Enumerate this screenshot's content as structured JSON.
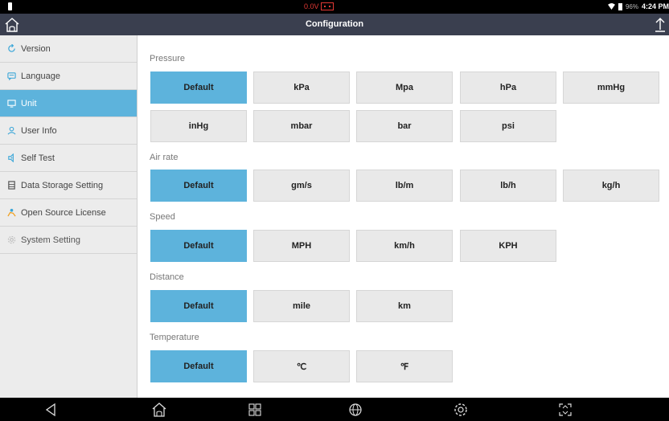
{
  "status": {
    "voltage": "0.0V",
    "battery_pct": "96%",
    "time": "4:24 PM"
  },
  "header": {
    "title": "Configuration"
  },
  "sidebar": {
    "items": [
      {
        "label": "Version",
        "icon": "refresh-icon"
      },
      {
        "label": "Language",
        "icon": "chat-icon"
      },
      {
        "label": "Unit",
        "icon": "monitor-icon"
      },
      {
        "label": "User Info",
        "icon": "user-icon"
      },
      {
        "label": "Self Test",
        "icon": "self-test-icon"
      },
      {
        "label": "Data Storage Setting",
        "icon": "storage-icon"
      },
      {
        "label": "Open Source License",
        "icon": "license-icon"
      },
      {
        "label": "System Setting",
        "icon": "gear-icon"
      }
    ],
    "active": "Unit"
  },
  "sections": {
    "pressure": {
      "label": "Pressure",
      "options": [
        "Default",
        "kPa",
        "Mpa",
        "hPa",
        "mmHg",
        "inHg",
        "mbar",
        "bar",
        "psi"
      ],
      "selected": "Default"
    },
    "air_rate": {
      "label": "Air rate",
      "options": [
        "Default",
        "gm/s",
        "lb/m",
        "lb/h",
        "kg/h"
      ],
      "selected": "Default"
    },
    "speed": {
      "label": "Speed",
      "options": [
        "Default",
        "MPH",
        "km/h",
        "KPH"
      ],
      "selected": "Default"
    },
    "distance": {
      "label": "Distance",
      "options": [
        "Default",
        "mile",
        "km"
      ],
      "selected": "Default"
    },
    "temperature": {
      "label": "Temperature",
      "options": [
        "Default",
        "℃",
        "℉"
      ],
      "selected": "Default"
    }
  },
  "colors": {
    "accent": "#5db3dc",
    "titlebar": "#3a3f4f",
    "sidebar_bg": "#ececec",
    "option_bg": "#e9e9e9"
  }
}
